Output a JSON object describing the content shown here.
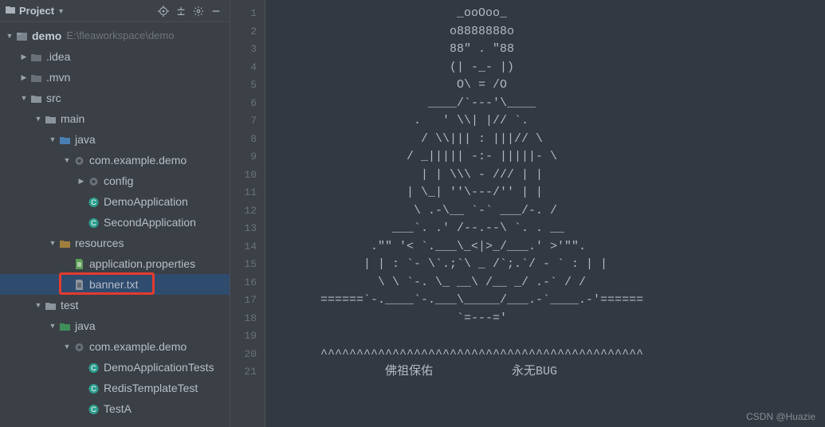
{
  "toolWindow": {
    "title": "Project",
    "dropdownIcon": "chevron-down-icon",
    "buttons": [
      "target-icon",
      "collapse-icon",
      "gear-icon",
      "minimize-icon"
    ]
  },
  "tree": [
    {
      "depth": 0,
      "arrow": "▼",
      "icon": "module",
      "label": "demo",
      "bold": true,
      "hint": "E:\\fleaworkspace\\demo"
    },
    {
      "depth": 1,
      "arrow": "▶",
      "icon": "folder-dim",
      "label": ".idea"
    },
    {
      "depth": 1,
      "arrow": "▶",
      "icon": "folder-dim",
      "label": ".mvn"
    },
    {
      "depth": 1,
      "arrow": "▼",
      "icon": "folder",
      "label": "src"
    },
    {
      "depth": 2,
      "arrow": "▼",
      "icon": "folder",
      "label": "main"
    },
    {
      "depth": 3,
      "arrow": "▼",
      "icon": "folder-src",
      "label": "java"
    },
    {
      "depth": 4,
      "arrow": "▼",
      "icon": "package",
      "label": "com.example.demo"
    },
    {
      "depth": 5,
      "arrow": "▶",
      "icon": "package",
      "label": "config"
    },
    {
      "depth": 5,
      "arrow": "",
      "icon": "class",
      "label": "DemoApplication"
    },
    {
      "depth": 5,
      "arrow": "",
      "icon": "class",
      "label": "SecondApplication"
    },
    {
      "depth": 3,
      "arrow": "▼",
      "icon": "folder-res",
      "label": "resources"
    },
    {
      "depth": 4,
      "arrow": "",
      "icon": "props",
      "label": "application.properties"
    },
    {
      "depth": 4,
      "arrow": "",
      "icon": "file",
      "label": "banner.txt",
      "selected": true,
      "highlight": true
    },
    {
      "depth": 2,
      "arrow": "▼",
      "icon": "folder",
      "label": "test"
    },
    {
      "depth": 3,
      "arrow": "▼",
      "icon": "folder-test",
      "label": "java"
    },
    {
      "depth": 4,
      "arrow": "▼",
      "icon": "package",
      "label": "com.example.demo"
    },
    {
      "depth": 5,
      "arrow": "",
      "icon": "class",
      "label": "DemoApplicationTests"
    },
    {
      "depth": 5,
      "arrow": "",
      "icon": "class",
      "label": "RedisTemplateTest"
    },
    {
      "depth": 5,
      "arrow": "",
      "icon": "class",
      "label": "TestA"
    }
  ],
  "gutter": {
    "start": 1,
    "end": 21
  },
  "banner_lines": [
    "                    _ooOoo_",
    "                   o8888888o",
    "                   88\" . \"88",
    "                   (| -_- |)",
    "                    O\\ = /O",
    "                ____/`---'\\____",
    "              .   ' \\\\| |// `.",
    "               / \\\\||| : |||// \\",
    "             / _||||| -:- |||||- \\",
    "               | | \\\\\\ - /// | |",
    "             | \\_| ''\\---/'' | |",
    "              \\ .-\\__ `-` ___/-. /",
    "           ___`. .' /--.--\\ `. . __",
    "        .\"\" '< `.___\\_<|>_/___.' >'\"\".",
    "       | | : `- \\`.;`\\ _ /`;.`/ - ` : | |",
    "         \\ \\ `-. \\_ __\\ /__ _/ .-` / /",
    " ======`-.____`-.___\\_____/___.-`____.-'======",
    "                    `=---='",
    "",
    " ^^^^^^^^^^^^^^^^^^^^^^^^^^^^^^^^^^^^^^^^^^^^^",
    "          佛祖保佑           永无BUG"
  ],
  "watermark": "CSDN @Huazie"
}
